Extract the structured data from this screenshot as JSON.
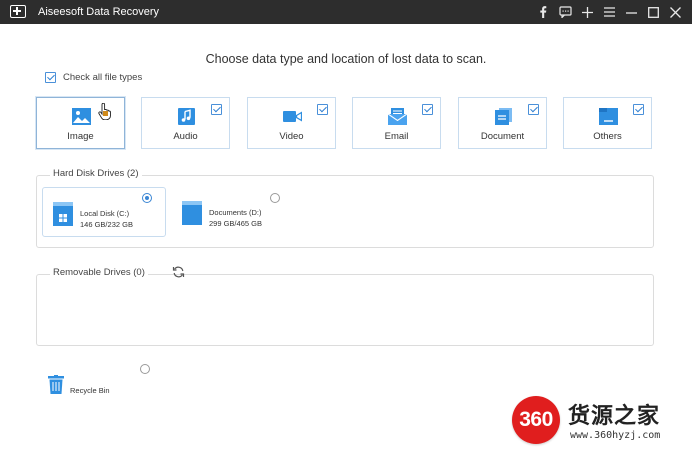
{
  "window": {
    "title": "Aiseesoft Data Recovery",
    "controls": [
      "facebook-icon",
      "chat-icon",
      "plus-icon",
      "menu-icon",
      "minimize-icon",
      "maximize-icon",
      "close-icon"
    ]
  },
  "heading": "Choose data type and location of lost data to scan.",
  "check_all": {
    "label": "Check all file types",
    "checked": true
  },
  "file_types": [
    {
      "id": "image",
      "label": "Image",
      "selected": true,
      "checked": false
    },
    {
      "id": "audio",
      "label": "Audio",
      "selected": false,
      "checked": true
    },
    {
      "id": "video",
      "label": "Video",
      "selected": false,
      "checked": true
    },
    {
      "id": "email",
      "label": "Email",
      "selected": false,
      "checked": true
    },
    {
      "id": "document",
      "label": "Document",
      "selected": false,
      "checked": true
    },
    {
      "id": "others",
      "label": "Others",
      "selected": false,
      "checked": true
    }
  ],
  "hard_disk": {
    "label": "Hard Disk Drives (2)",
    "drives": [
      {
        "name": "Local Disk (C:)",
        "size": "146 GB/232 GB",
        "selected": true
      },
      {
        "name": "Documents (D:)",
        "size": "299 GB/465 GB",
        "selected": false
      }
    ]
  },
  "removable": {
    "label": "Removable Drives (0)"
  },
  "recycle_bin": {
    "label": "Recycle Bin",
    "selected": false
  },
  "watermark": {
    "number": "360",
    "brand": "货源之家",
    "url": "www.360hyzj.com"
  },
  "colors": {
    "accent": "#2f8fe0",
    "titlebar": "#2d2d2d",
    "card_border": "#c8dcef"
  }
}
